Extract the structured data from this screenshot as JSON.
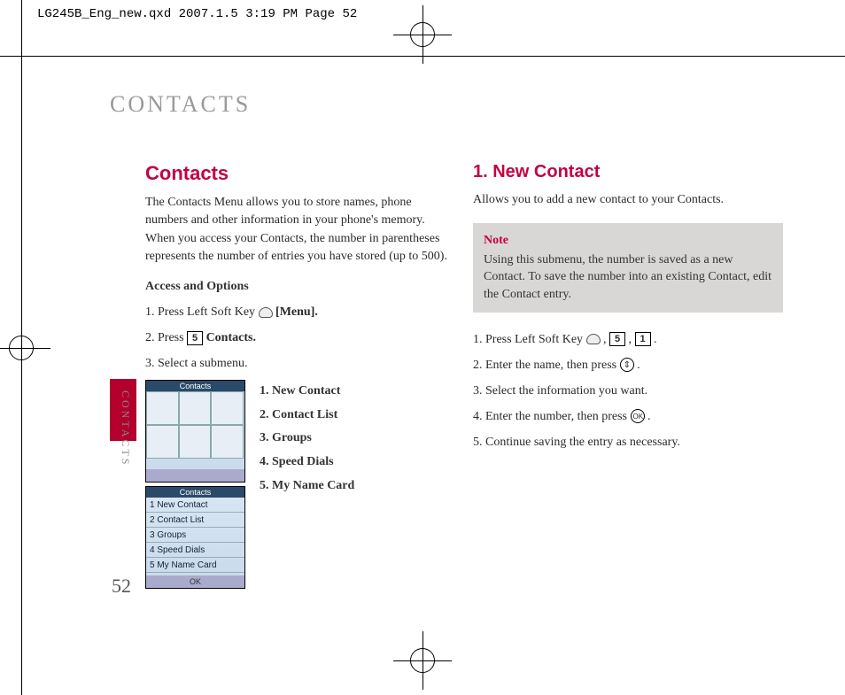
{
  "header_strip": "LG245B_Eng_new.qxd  2007.1.5  3:19 PM  Page 52",
  "chapter_title": "CONTACTS",
  "side_label": "CONTACTS",
  "page_number": "52",
  "left": {
    "h2": "Contacts",
    "intro": "The Contacts Menu allows you to store names, phone numbers and other information in your phone's memory. When you access your Contacts, the number in parentheses represents the number of entries you have stored (up to 500).",
    "access_heading": "Access and Options",
    "step1_pre": "1.  Press Left Soft Key ",
    "step1_post": " [Menu].",
    "step2_pre": "2.  Press ",
    "step2_key": "5",
    "step2_post": " Contacts.",
    "step3": "3.  Select a submenu.",
    "screens": {
      "s1_title": "Contacts",
      "s2_title": "Contacts",
      "s2_rows": [
        "1 New Contact",
        "2 Contact List",
        "3 Groups",
        "4 Speed Dials",
        "5 My Name Card"
      ],
      "s2_ok": "OK"
    },
    "submenu": [
      "1. New Contact",
      "2. Contact List",
      "3. Groups",
      "4. Speed Dials",
      "5. My Name Card"
    ]
  },
  "right": {
    "h2": "1. New Contact",
    "intro": "Allows you to add a new contact to your Contacts.",
    "note_title": "Note",
    "note_body": "Using this submenu, the number is saved as a new Contact. To save the number into an existing Contact, edit the Contact entry.",
    "step1_pre": "1. Press Left Soft Key ",
    "step1_k1": "5",
    "step1_k2": "1",
    "step1_post": ".",
    "step2_pre": "2. Enter the name, then press ",
    "step2_post": ".",
    "step3": "3. Select the information you want.",
    "step4_pre": "4. Enter the number, then press ",
    "step4_post": ".",
    "step5": "5. Continue saving the entry as necessary."
  }
}
